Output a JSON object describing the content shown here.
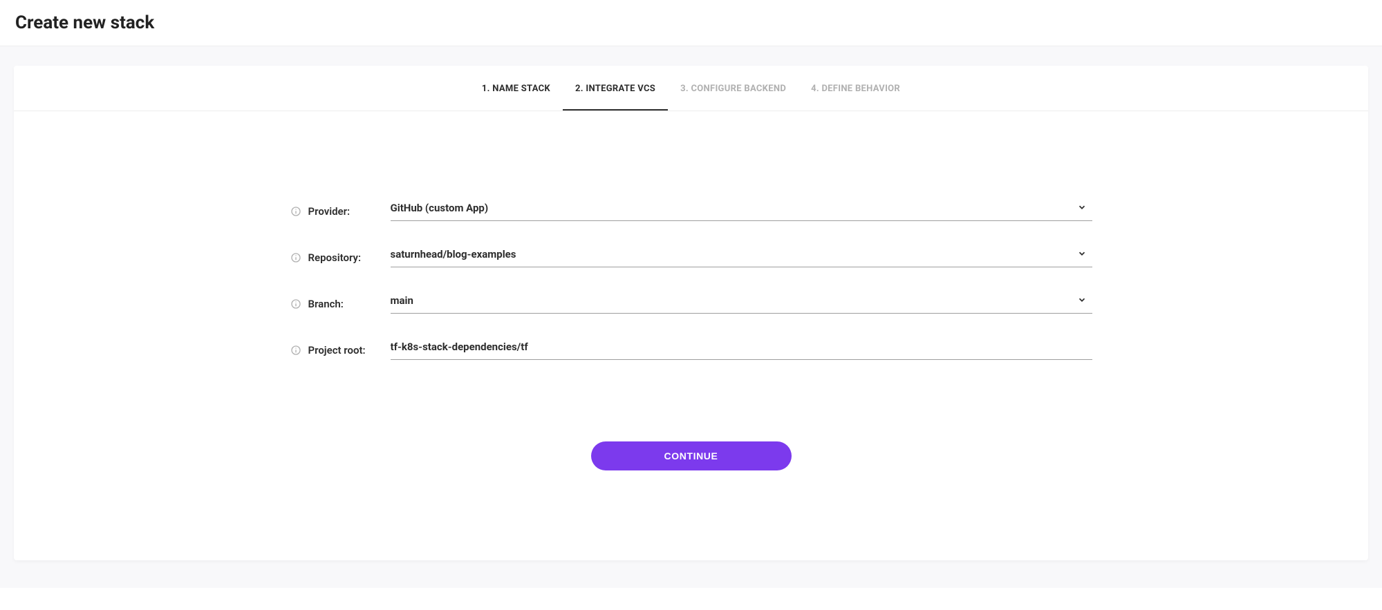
{
  "page": {
    "title": "Create new stack"
  },
  "tabs": [
    {
      "label": "1. NAME STACK",
      "state": "done"
    },
    {
      "label": "2. INTEGRATE VCS",
      "state": "active"
    },
    {
      "label": "3. CONFIGURE BACKEND",
      "state": "pending"
    },
    {
      "label": "4. DEFINE BEHAVIOR",
      "state": "pending"
    }
  ],
  "fields": {
    "provider": {
      "label": "Provider:",
      "value": "GitHub (custom App)",
      "type": "select"
    },
    "repository": {
      "label": "Repository:",
      "value": "saturnhead/blog-examples",
      "type": "select"
    },
    "branch": {
      "label": "Branch:",
      "value": "main",
      "type": "select"
    },
    "project_root": {
      "label": "Project root:",
      "value": "tf-k8s-stack-dependencies/tf",
      "type": "text"
    }
  },
  "actions": {
    "continue": "CONTINUE"
  },
  "colors": {
    "accent": "#7c3aed"
  }
}
